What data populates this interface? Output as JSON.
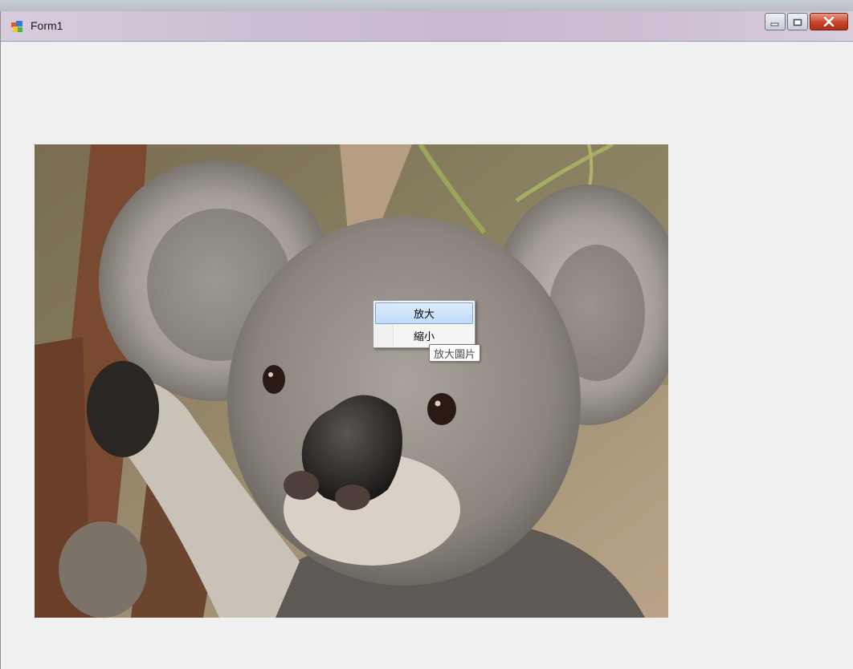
{
  "window": {
    "title": "Form1",
    "icon": "form-app-icon"
  },
  "caption_buttons": {
    "minimize_icon": "minimize-icon",
    "maximize_icon": "maximize-icon",
    "close_icon": "close-icon"
  },
  "picture": {
    "subject_icon": "koala-photo"
  },
  "context_menu": {
    "items": [
      {
        "label": "放大",
        "highlighted": true
      },
      {
        "label": "縮小",
        "highlighted": false
      }
    ]
  },
  "tooltip": {
    "text": "放大圖片"
  },
  "colors": {
    "menu_highlight": "#c1dcfc",
    "close_button": "#c8442c",
    "form_background": "#f0f0f0"
  }
}
